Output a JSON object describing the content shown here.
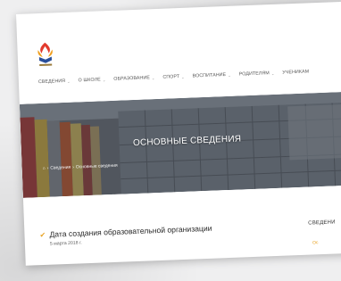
{
  "nav": [
    {
      "label": "СВЕДЕНИЯ"
    },
    {
      "label": "О ШКОЛЕ"
    },
    {
      "label": "ОБРАЗОВАНИЕ"
    },
    {
      "label": "СПОРТ"
    },
    {
      "label": "ВОСПИТАНИЕ"
    },
    {
      "label": "РОДИТЕЛЯМ"
    },
    {
      "label": "УЧЕНИКАМ"
    }
  ],
  "hero": {
    "title": "ОСНОВНЫЕ СВЕДЕНИЯ",
    "breadcrumb": [
      "Сведения",
      "Основные сведения"
    ]
  },
  "post": {
    "title": "Дата создания образовательной организации",
    "date": "5 марта 2018 г."
  },
  "sidebar": {
    "title": "СВЕДЕНИ",
    "link": "Ос"
  },
  "colors": {
    "accent": "#e8a11e",
    "hero_overlay": "#3a3f47"
  }
}
